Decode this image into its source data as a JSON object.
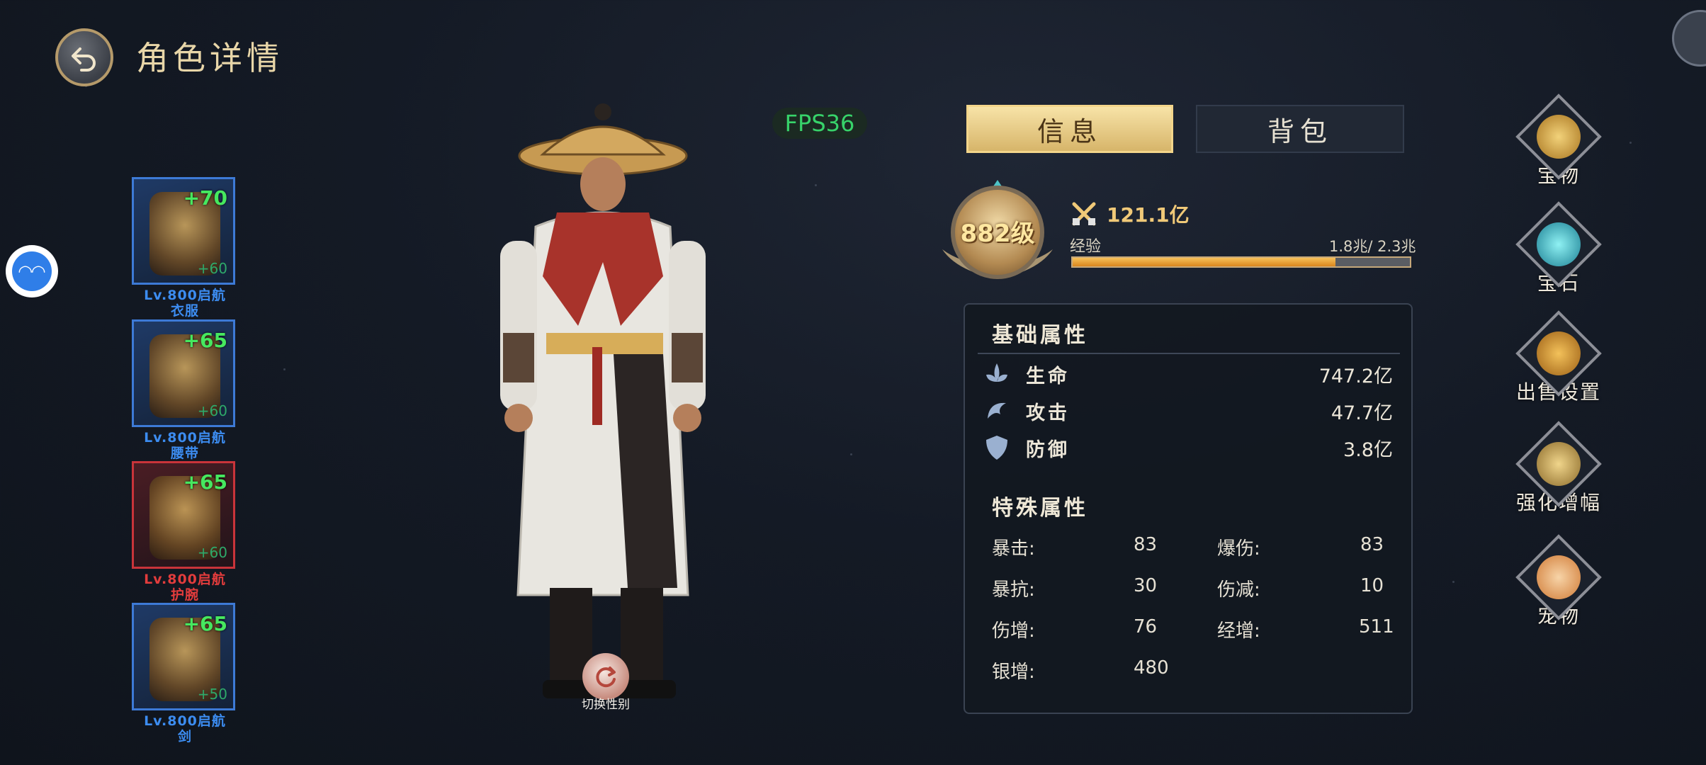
{
  "header": {
    "title": "角色详情"
  },
  "fps": "FPS36",
  "equipment": [
    {
      "plus": "+70",
      "sub": "+60",
      "name_line1": "Lv.800启航",
      "name_line2": "衣服",
      "quality": "blue"
    },
    {
      "plus": "+65",
      "sub": "+60",
      "name_line1": "Lv.800启航",
      "name_line2": "腰带",
      "quality": "blue"
    },
    {
      "plus": "+65",
      "sub": "+60",
      "name_line1": "Lv.800启航",
      "name_line2": "护腕",
      "quality": "red"
    },
    {
      "plus": "+65",
      "sub": "+50",
      "name_line1": "Lv.800启航",
      "name_line2": "剑",
      "quality": "blue"
    }
  ],
  "character": {
    "switch_gender_label": "切换性别"
  },
  "tabs": {
    "info": "信息",
    "bag": "背包",
    "active": "info"
  },
  "level": "882级",
  "power": "121.1亿",
  "exp": {
    "label": "经验",
    "value": "1.8兆/ 2.3兆",
    "fraction": 0.78
  },
  "attributes": {
    "base_title": "基础属性",
    "base": [
      {
        "label": "生命",
        "value": "747.2亿",
        "icon": "lotus-icon"
      },
      {
        "label": "攻击",
        "value": "47.7亿",
        "icon": "swirl-icon"
      },
      {
        "label": "防御",
        "value": "3.8亿",
        "icon": "shield-icon"
      }
    ],
    "special_title": "特殊属性",
    "special": [
      {
        "label": "暴击:",
        "value": "83"
      },
      {
        "label": "爆伤:",
        "value": "83"
      },
      {
        "label": "暴抗:",
        "value": "30"
      },
      {
        "label": "伤减:",
        "value": "10"
      },
      {
        "label": "伤增:",
        "value": "76"
      },
      {
        "label": "经增:",
        "value": "511"
      },
      {
        "label": "银增:",
        "value": "480"
      }
    ]
  },
  "side_menu": [
    {
      "label": "宝物",
      "icon": "treasure-chest-icon",
      "color": "#d8a63a"
    },
    {
      "label": "宝石",
      "icon": "gem-icon",
      "color": "#2bb7c8"
    },
    {
      "label": "出售设置",
      "icon": "gear-icon",
      "color": "#d89a2c"
    },
    {
      "label": "强化增幅",
      "icon": "anvil-icon",
      "color": "#c9a24a"
    },
    {
      "label": "宠物",
      "icon": "pet-fox-icon",
      "color": "#e0934a"
    }
  ],
  "colors": {
    "accent_gold": "#e8d6a8",
    "fps_green": "#37d36a",
    "plus_green": "#46e85f",
    "equip_blue": "#3c8cf0",
    "equip_red": "#e23c3c"
  }
}
